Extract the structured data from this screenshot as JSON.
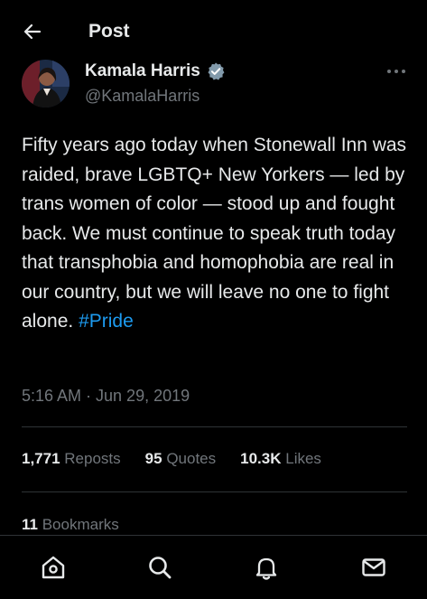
{
  "header": {
    "title": "Post",
    "back_icon": "arrow-left-icon"
  },
  "author": {
    "name": "Kamala Harris",
    "handle": "@KamalaHarris",
    "verified": true,
    "avatar_icon": "profile-photo"
  },
  "post": {
    "text_before": "Fifty years ago today when Stonewall Inn was raided, brave LGBTQ+ New Yorkers — led by trans women of color — stood up and fought back. We must continue to speak truth today that transphobia and homophobia are real in our country, but we will leave no one to fight alone. ",
    "hashtag": "#Pride",
    "timestamp": "5:16 AM · Jun 29, 2019"
  },
  "stats": {
    "reposts_count": "1,771",
    "reposts_label": "Reposts",
    "quotes_count": "95",
    "quotes_label": "Quotes",
    "likes_count": "10.3K",
    "likes_label": "Likes",
    "bookmarks_count": "11",
    "bookmarks_label": "Bookmarks"
  },
  "nav": {
    "items": [
      "home-icon",
      "search-icon",
      "notifications-icon",
      "messages-icon"
    ]
  },
  "colors": {
    "background": "#000000",
    "text": "#e7e9ea",
    "muted": "#71767b",
    "accent": "#1d9bf0",
    "divider": "#2f3336"
  }
}
